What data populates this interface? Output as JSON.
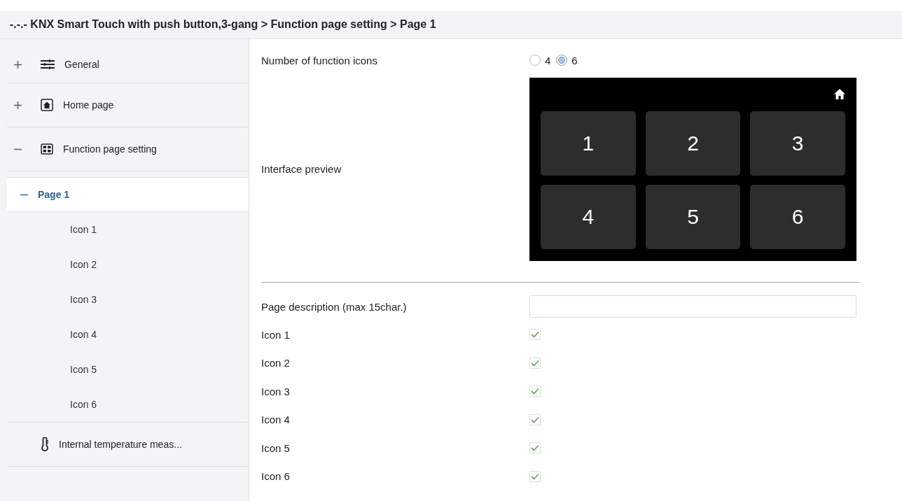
{
  "breadcrumb": "-.-.- KNX Smart Touch with push button,3-gang > Function page setting > Page 1",
  "sidebar": {
    "items": [
      {
        "label": "General",
        "expanded": false,
        "selected": false
      },
      {
        "label": "Home page",
        "expanded": false,
        "selected": false
      },
      {
        "label": "Function page setting",
        "expanded": true,
        "selected": false,
        "children": [
          {
            "label": "Page 1",
            "expanded": true,
            "selected": true,
            "children": [
              {
                "label": "Icon 1",
                "selected": false
              },
              {
                "label": "Icon 2",
                "selected": false
              },
              {
                "label": "Icon 3",
                "selected": false
              },
              {
                "label": "Icon 4",
                "selected": false
              },
              {
                "label": "Icon 5",
                "selected": false
              },
              {
                "label": "Icon 6",
                "selected": false
              }
            ]
          }
        ]
      },
      {
        "label": "Internal temperature meas...",
        "selected": false
      }
    ]
  },
  "settings": {
    "function_icons": {
      "label": "Number of  function icons",
      "options": [
        {
          "label": "4",
          "selected": false
        },
        {
          "label": "6",
          "selected": true
        }
      ]
    },
    "preview": {
      "label": "Interface preview",
      "tiles": [
        "1",
        "2",
        "3",
        "4",
        "5",
        "6"
      ]
    },
    "page_description": {
      "label": "Page description (max 15char.)"
    },
    "icons": [
      {
        "label": "Icon 1",
        "checked": true
      },
      {
        "label": "Icon 2",
        "checked": true
      },
      {
        "label": "Icon 3",
        "checked": true
      },
      {
        "label": "Icon 4",
        "checked": true
      },
      {
        "label": "Icon 5",
        "checked": true
      },
      {
        "label": "Icon 6",
        "checked": true
      }
    ]
  }
}
